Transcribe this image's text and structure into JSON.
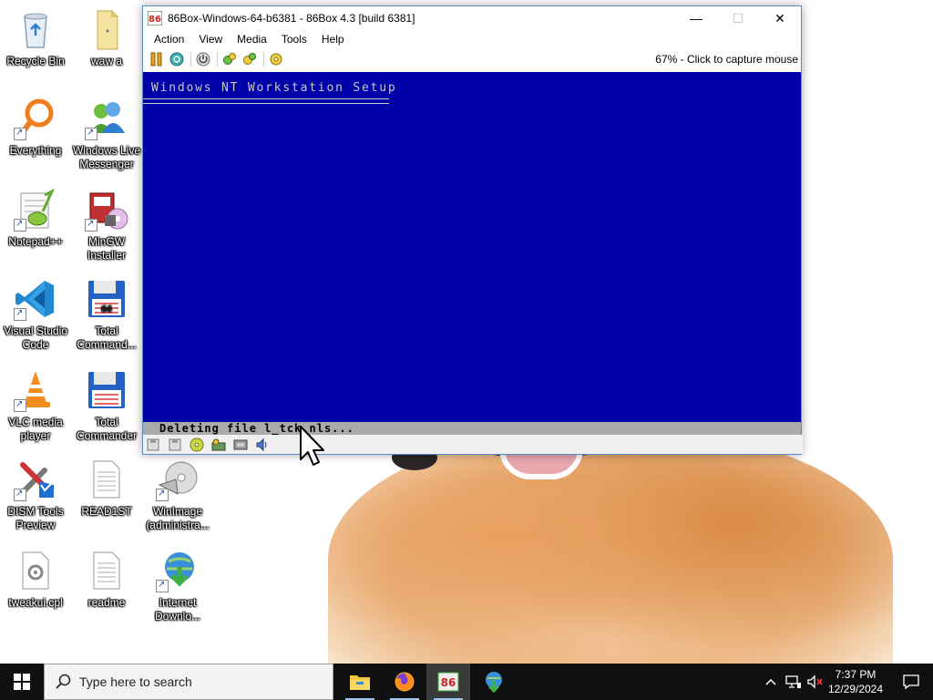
{
  "desktop": {
    "icons": [
      {
        "label": "Recycle Bin",
        "icon": "recycle-bin-icon"
      },
      {
        "label": "waw a",
        "icon": "folder-icon"
      },
      {
        "label": "Everything",
        "icon": "everything-search-icon"
      },
      {
        "label": "Windows Live Messenger",
        "icon": "messenger-icon"
      },
      {
        "label": "Notepad++",
        "icon": "notepad-plus-plus-icon"
      },
      {
        "label": "MinGW Installer",
        "icon": "mingw-installer-icon"
      },
      {
        "label": "Visual Studio Code",
        "icon": "vscode-icon"
      },
      {
        "label": "Total Command...",
        "icon": "total-commander-64-icon"
      },
      {
        "label": "VLC media player",
        "icon": "vlc-icon"
      },
      {
        "label": "Total Commander",
        "icon": "total-commander-icon"
      },
      {
        "label": "DISM Tools Preview",
        "icon": "dism-tools-icon"
      },
      {
        "label": "READ1ST",
        "icon": "text-document-icon"
      },
      {
        "label": "WinImage (administra...",
        "icon": "winimage-icon"
      },
      {
        "label": "tweakui.cpl",
        "icon": "control-panel-file-icon"
      },
      {
        "label": "readme",
        "icon": "text-document-icon"
      },
      {
        "label": "Internet Downlo...",
        "icon": "internet-download-manager-icon"
      }
    ]
  },
  "window": {
    "title": "86Box-Windows-64-b6381 - 86Box 4.3 [build 6381]",
    "menu": [
      "Action",
      "View",
      "Media",
      "Tools",
      "Help"
    ],
    "capture_status": "67% - Click to capture mouse",
    "setup_title": "Windows NT Workstation Setup",
    "setup_status": "Deleting file l_tck.nls...",
    "screen_color": "#0000a8"
  },
  "taskbar": {
    "search_placeholder": "Type here to search",
    "apps": [
      "file-explorer-icon",
      "firefox-icon",
      "86box-icon",
      "internet-download-manager-icon"
    ],
    "time": "7:37 PM",
    "date": "12/29/2024"
  }
}
